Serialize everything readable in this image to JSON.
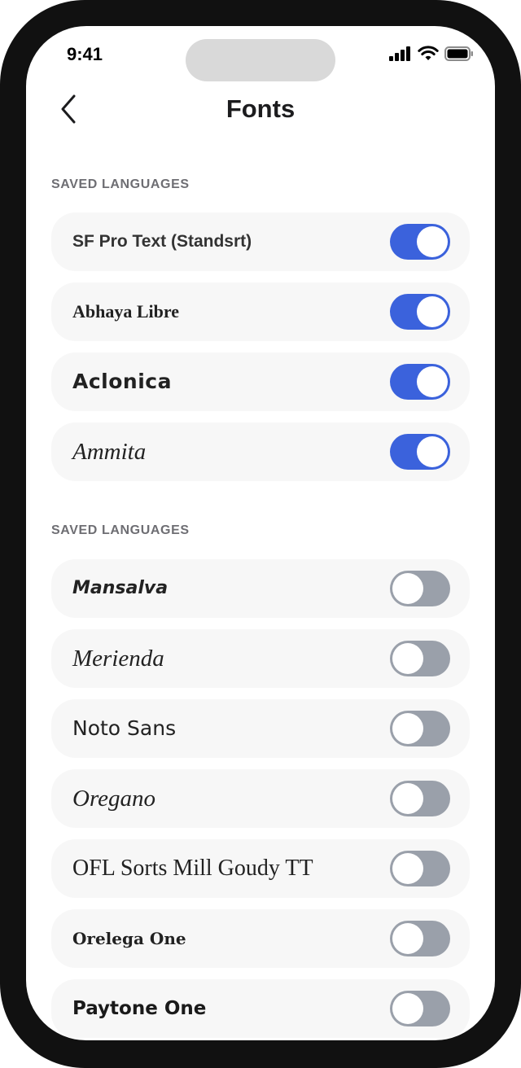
{
  "status_bar": {
    "time": "9:41",
    "icons": [
      "cellular-signal-icon",
      "wifi-icon",
      "battery-icon"
    ]
  },
  "nav": {
    "back_icon": "chevron-left-icon",
    "title": "Fonts"
  },
  "sections": [
    {
      "header": "SAVED LANGUAGES",
      "items": [
        {
          "label": "SF Pro Text (Standsrt)",
          "enabled": true
        },
        {
          "label": "Abhaya Libre",
          "enabled": true
        },
        {
          "label": "Aclonica",
          "enabled": true
        },
        {
          "label": "Ammita",
          "enabled": true
        }
      ]
    },
    {
      "header": "SAVED LANGUAGES",
      "items": [
        {
          "label": "Mansalva",
          "enabled": false
        },
        {
          "label": "Merienda",
          "enabled": false
        },
        {
          "label": "Noto Sans",
          "enabled": false
        },
        {
          "label": "Oregano",
          "enabled": false
        },
        {
          "label": "OFL Sorts Mill Goudy TT",
          "enabled": false
        },
        {
          "label": "Orelega One",
          "enabled": false
        },
        {
          "label": "Paytone One",
          "enabled": false
        }
      ]
    }
  ],
  "colors": {
    "toggle_on": "#3b62dc",
    "toggle_off": "#9aa0aa",
    "row_background": "#f7f7f7"
  }
}
